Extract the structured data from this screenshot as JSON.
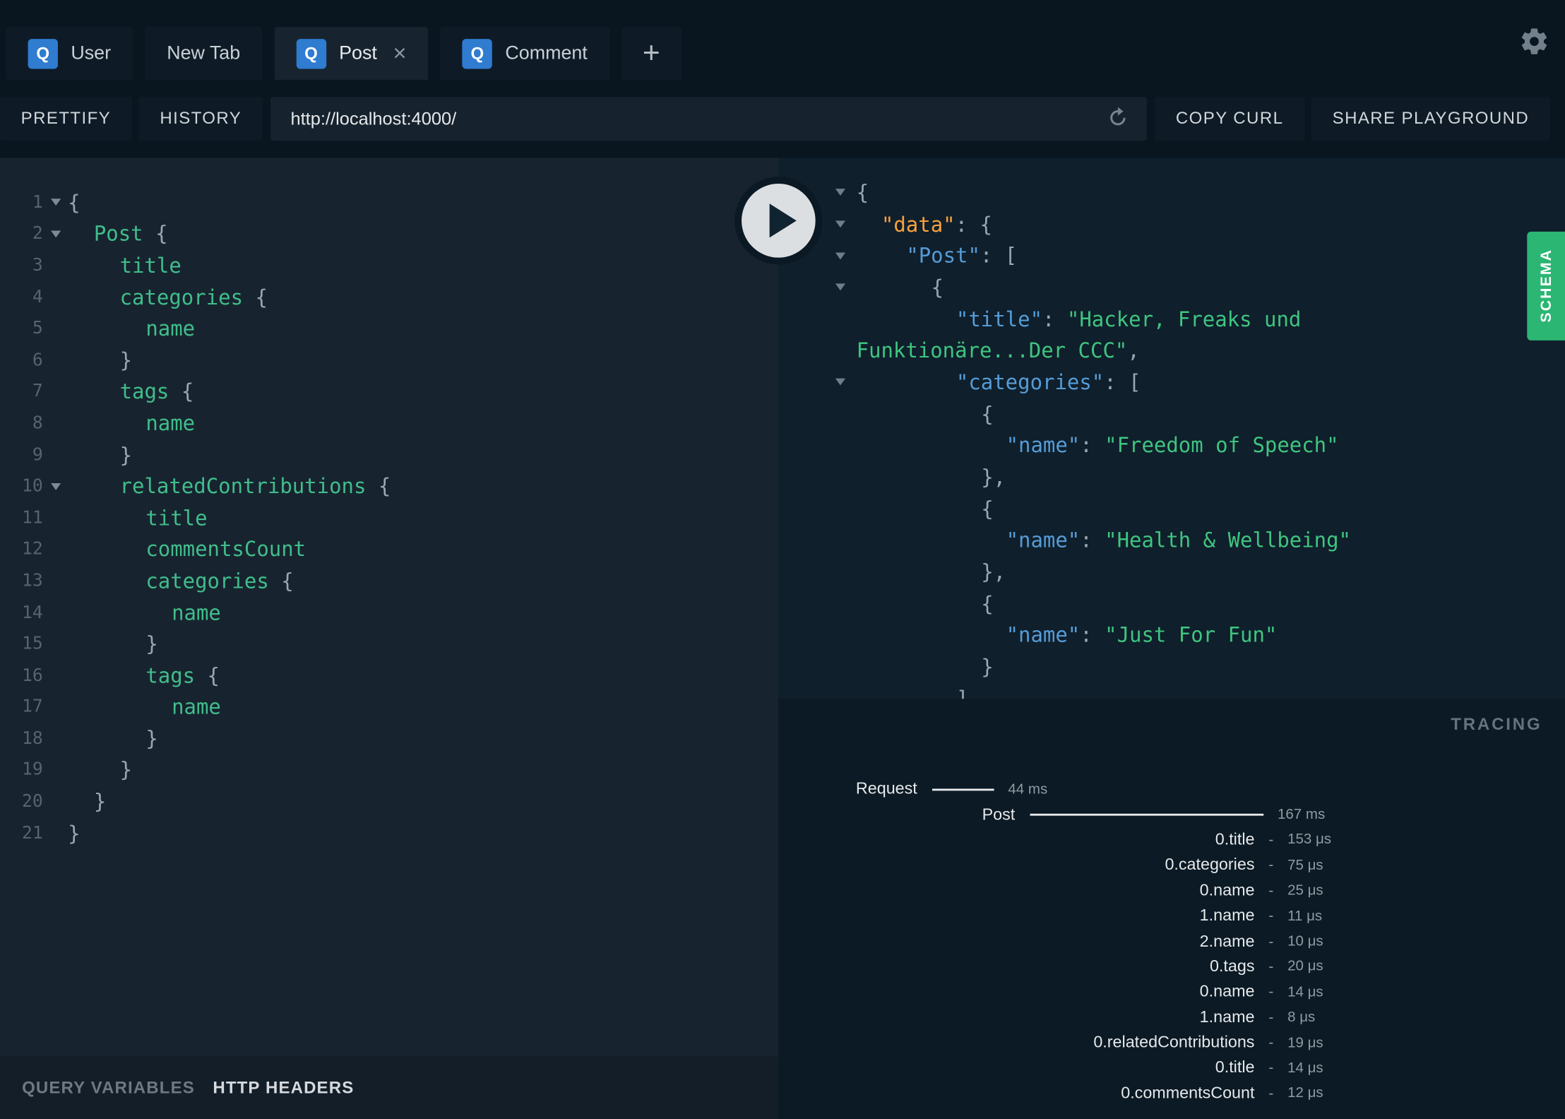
{
  "colors": {
    "badge_blue": "#2f7cd0",
    "schema_green": "#2bb673",
    "field_green": "#41bd8b",
    "string_green": "#3fc57f",
    "key_blue": "#569cd6",
    "key_orange": "#f9a13c"
  },
  "tabs": {
    "badge_letter": "Q",
    "close_label": "×",
    "add_label": "+",
    "items": [
      {
        "label": "User",
        "badge": true,
        "active": false,
        "closable": false
      },
      {
        "label": "New Tab",
        "badge": false,
        "active": false,
        "closable": false
      },
      {
        "label": "Post",
        "badge": true,
        "active": true,
        "closable": true
      },
      {
        "label": "Comment",
        "badge": true,
        "active": false,
        "closable": false
      }
    ]
  },
  "toolbar": {
    "prettify": "PRETTIFY",
    "history": "HISTORY",
    "url": "http://localhost:4000/",
    "copy_curl": "COPY CURL",
    "share": "SHARE PLAYGROUND"
  },
  "editor": {
    "lines": [
      {
        "n": 1,
        "indent": 0,
        "fold": true,
        "tokens": [
          [
            "punct",
            "{"
          ]
        ]
      },
      {
        "n": 2,
        "indent": 1,
        "fold": true,
        "tokens": [
          [
            "field",
            "Post"
          ],
          [
            "punct",
            " {"
          ]
        ]
      },
      {
        "n": 3,
        "indent": 2,
        "fold": false,
        "tokens": [
          [
            "field",
            "title"
          ]
        ]
      },
      {
        "n": 4,
        "indent": 2,
        "fold": false,
        "tokens": [
          [
            "field",
            "categories"
          ],
          [
            "punct",
            " {"
          ]
        ]
      },
      {
        "n": 5,
        "indent": 3,
        "fold": false,
        "tokens": [
          [
            "field",
            "name"
          ]
        ]
      },
      {
        "n": 6,
        "indent": 2,
        "fold": false,
        "tokens": [
          [
            "punct",
            "}"
          ]
        ]
      },
      {
        "n": 7,
        "indent": 2,
        "fold": false,
        "tokens": [
          [
            "field",
            "tags"
          ],
          [
            "punct",
            " {"
          ]
        ]
      },
      {
        "n": 8,
        "indent": 3,
        "fold": false,
        "tokens": [
          [
            "field",
            "name"
          ]
        ]
      },
      {
        "n": 9,
        "indent": 2,
        "fold": false,
        "tokens": [
          [
            "punct",
            "}"
          ]
        ]
      },
      {
        "n": 10,
        "indent": 2,
        "fold": true,
        "tokens": [
          [
            "field",
            "relatedContributions"
          ],
          [
            "punct",
            " {"
          ]
        ]
      },
      {
        "n": 11,
        "indent": 3,
        "fold": false,
        "tokens": [
          [
            "field",
            "title"
          ]
        ]
      },
      {
        "n": 12,
        "indent": 3,
        "fold": false,
        "tokens": [
          [
            "field",
            "commentsCount"
          ]
        ]
      },
      {
        "n": 13,
        "indent": 3,
        "fold": false,
        "tokens": [
          [
            "field",
            "categories"
          ],
          [
            "punct",
            " {"
          ]
        ]
      },
      {
        "n": 14,
        "indent": 4,
        "fold": false,
        "tokens": [
          [
            "field",
            "name"
          ]
        ]
      },
      {
        "n": 15,
        "indent": 3,
        "fold": false,
        "tokens": [
          [
            "punct",
            "}"
          ]
        ]
      },
      {
        "n": 16,
        "indent": 3,
        "fold": false,
        "tokens": [
          [
            "field",
            "tags"
          ],
          [
            "punct",
            " {"
          ]
        ]
      },
      {
        "n": 17,
        "indent": 4,
        "fold": false,
        "tokens": [
          [
            "field",
            "name"
          ]
        ]
      },
      {
        "n": 18,
        "indent": 3,
        "fold": false,
        "tokens": [
          [
            "punct",
            "}"
          ]
        ]
      },
      {
        "n": 19,
        "indent": 2,
        "fold": false,
        "tokens": [
          [
            "punct",
            "}"
          ]
        ]
      },
      {
        "n": 20,
        "indent": 1,
        "fold": false,
        "tokens": [
          [
            "punct",
            "}"
          ]
        ]
      },
      {
        "n": 21,
        "indent": 0,
        "fold": false,
        "tokens": [
          [
            "punct",
            "}"
          ]
        ]
      }
    ]
  },
  "response": {
    "lines": [
      {
        "indent": 0,
        "fold": true,
        "tokens": [
          [
            "punct",
            "{"
          ]
        ]
      },
      {
        "indent": 1,
        "fold": true,
        "tokens": [
          [
            "key_data",
            "\"data\""
          ],
          [
            "punct",
            ": {"
          ]
        ]
      },
      {
        "indent": 2,
        "fold": true,
        "tokens": [
          [
            "key",
            "\"Post\""
          ],
          [
            "punct",
            ": ["
          ]
        ]
      },
      {
        "indent": 3,
        "fold": true,
        "tokens": [
          [
            "punct",
            "{"
          ]
        ]
      },
      {
        "indent": 4,
        "fold": false,
        "tokens": [
          [
            "key",
            "\"title\""
          ],
          [
            "punct",
            ": "
          ],
          [
            "string",
            "\"Hacker, Freaks und"
          ]
        ]
      },
      {
        "indent": 0,
        "fold": false,
        "tokens": [
          [
            "string",
            "Funktionäre...Der CCC\""
          ],
          [
            "punct",
            ","
          ]
        ]
      },
      {
        "indent": 4,
        "fold": true,
        "tokens": [
          [
            "key",
            "\"categories\""
          ],
          [
            "punct",
            ": ["
          ]
        ]
      },
      {
        "indent": 5,
        "fold": false,
        "tokens": [
          [
            "punct",
            "{"
          ]
        ]
      },
      {
        "indent": 6,
        "fold": false,
        "tokens": [
          [
            "key",
            "\"name\""
          ],
          [
            "punct",
            ": "
          ],
          [
            "string",
            "\"Freedom of Speech\""
          ]
        ]
      },
      {
        "indent": 5,
        "fold": false,
        "tokens": [
          [
            "punct",
            "},"
          ]
        ]
      },
      {
        "indent": 5,
        "fold": false,
        "tokens": [
          [
            "punct",
            "{"
          ]
        ]
      },
      {
        "indent": 6,
        "fold": false,
        "tokens": [
          [
            "key",
            "\"name\""
          ],
          [
            "punct",
            ": "
          ],
          [
            "string",
            "\"Health & Wellbeing\""
          ]
        ]
      },
      {
        "indent": 5,
        "fold": false,
        "tokens": [
          [
            "punct",
            "},"
          ]
        ]
      },
      {
        "indent": 5,
        "fold": false,
        "tokens": [
          [
            "punct",
            "{"
          ]
        ]
      },
      {
        "indent": 6,
        "fold": false,
        "tokens": [
          [
            "key",
            "\"name\""
          ],
          [
            "punct",
            ": "
          ],
          [
            "string",
            "\"Just For Fun\""
          ]
        ]
      },
      {
        "indent": 5,
        "fold": false,
        "tokens": [
          [
            "punct",
            "}"
          ]
        ]
      },
      {
        "indent": 4,
        "fold": false,
        "tokens": [
          [
            "punct",
            "]"
          ]
        ]
      }
    ]
  },
  "schema_tab": "SCHEMA",
  "footer": {
    "query_variables": "QUERY VARIABLES",
    "http_headers": "HTTP HEADERS"
  },
  "tracing": {
    "title": "TRACING",
    "rows": [
      {
        "label": "Request",
        "depth": 0,
        "bar_ms": 44,
        "duration": "44 ms"
      },
      {
        "label": "Post",
        "depth": 1,
        "bar_ms": 167,
        "duration": "167 ms"
      },
      {
        "label": "0.title",
        "depth": 2,
        "duration": "153 μs"
      },
      {
        "label": "0.categories",
        "depth": 2,
        "duration": "75 μs"
      },
      {
        "label": "0.name",
        "depth": 2,
        "duration": "25 μs"
      },
      {
        "label": "1.name",
        "depth": 2,
        "duration": "11 μs"
      },
      {
        "label": "2.name",
        "depth": 2,
        "duration": "10 μs"
      },
      {
        "label": "0.tags",
        "depth": 2,
        "duration": "20 μs"
      },
      {
        "label": "0.name",
        "depth": 2,
        "duration": "14 μs"
      },
      {
        "label": "1.name",
        "depth": 2,
        "duration": "8 μs"
      },
      {
        "label": "0.relatedContributions",
        "depth": 2,
        "duration": "19 μs"
      },
      {
        "label": "0.title",
        "depth": 2,
        "duration": "14 μs"
      },
      {
        "label": "0.commentsCount",
        "depth": 2,
        "duration": "12 μs"
      }
    ]
  }
}
